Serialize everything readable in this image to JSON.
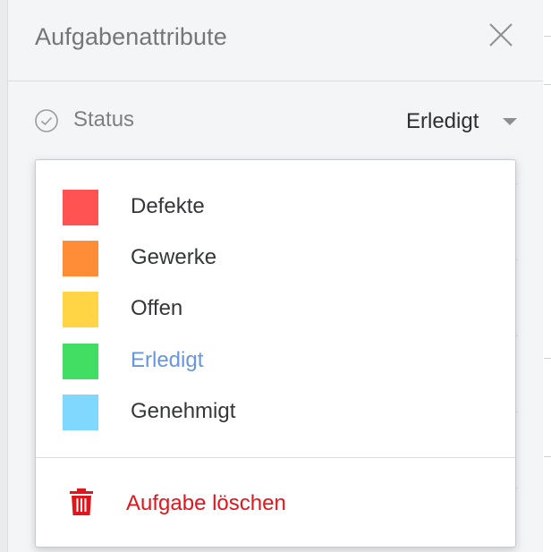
{
  "panel": {
    "title": "Aufgabenattribute",
    "close_icon": "close-icon"
  },
  "status": {
    "label": "Status",
    "icon": "check-circle-icon",
    "selected_value": "Erledigt",
    "caret_icon": "caret-down-icon"
  },
  "dropdown": {
    "options": [
      {
        "label": "Defekte",
        "color": "#ff5252",
        "selected": false
      },
      {
        "label": "Gewerke",
        "color": "#ff8c37",
        "selected": false
      },
      {
        "label": "Offen",
        "color": "#ffd545",
        "selected": false
      },
      {
        "label": "Erledigt",
        "color": "#42de64",
        "selected": true
      },
      {
        "label": "Genehmigt",
        "color": "#80d8ff",
        "selected": false
      }
    ],
    "delete_label": "Aufgabe löschen",
    "delete_icon": "trash-icon",
    "delete_color": "#e0161c",
    "selected_text_color": "#6796e0"
  }
}
